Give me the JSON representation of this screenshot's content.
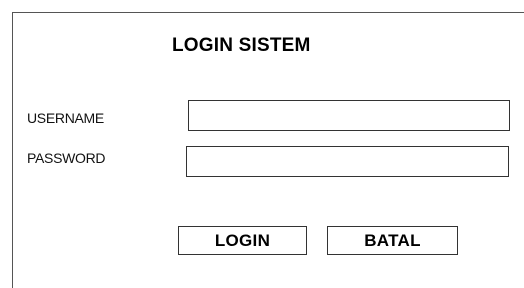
{
  "form": {
    "title": "LOGIN SISTEM",
    "username_label": "USERNAME",
    "username_value": "",
    "password_label": "PASSWORD",
    "password_value": "",
    "login_label": "LOGIN",
    "cancel_label": "BATAL"
  }
}
